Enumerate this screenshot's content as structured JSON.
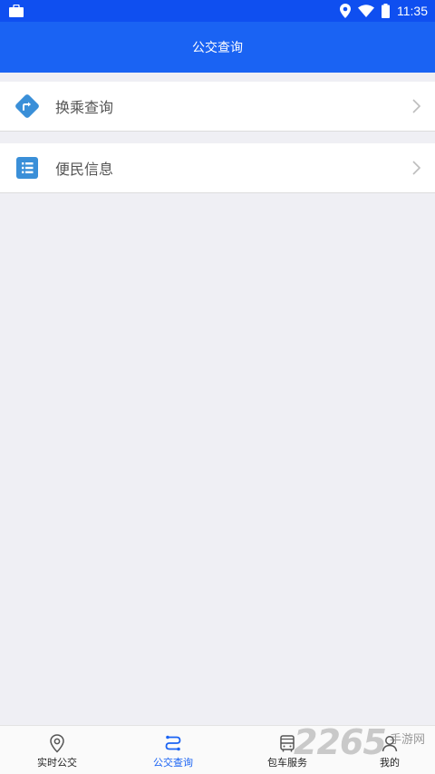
{
  "status_bar": {
    "time": "11:35",
    "icons": [
      "bag-icon",
      "location-icon",
      "wifi-icon",
      "battery-icon"
    ]
  },
  "app_bar": {
    "title": "公交查询",
    "color": "#1a63f3"
  },
  "menu": [
    {
      "label": "换乘查询",
      "icon": "transfer-route-icon",
      "icon_color": "#3a8fd8"
    },
    {
      "label": "便民信息",
      "icon": "list-info-icon",
      "icon_color": "#3a8fd8"
    }
  ],
  "bottom_nav": {
    "items": [
      {
        "label": "实时公交",
        "icon": "location-pin-icon",
        "active": false
      },
      {
        "label": "公交查询",
        "icon": "route-icon",
        "active": true
      },
      {
        "label": "包车服务",
        "icon": "bus-icon",
        "active": false
      },
      {
        "label": "我的",
        "icon": "person-icon",
        "active": false
      }
    ],
    "active_color": "#1a63f3"
  },
  "watermark": {
    "number": "2265",
    "text": "手游网"
  }
}
